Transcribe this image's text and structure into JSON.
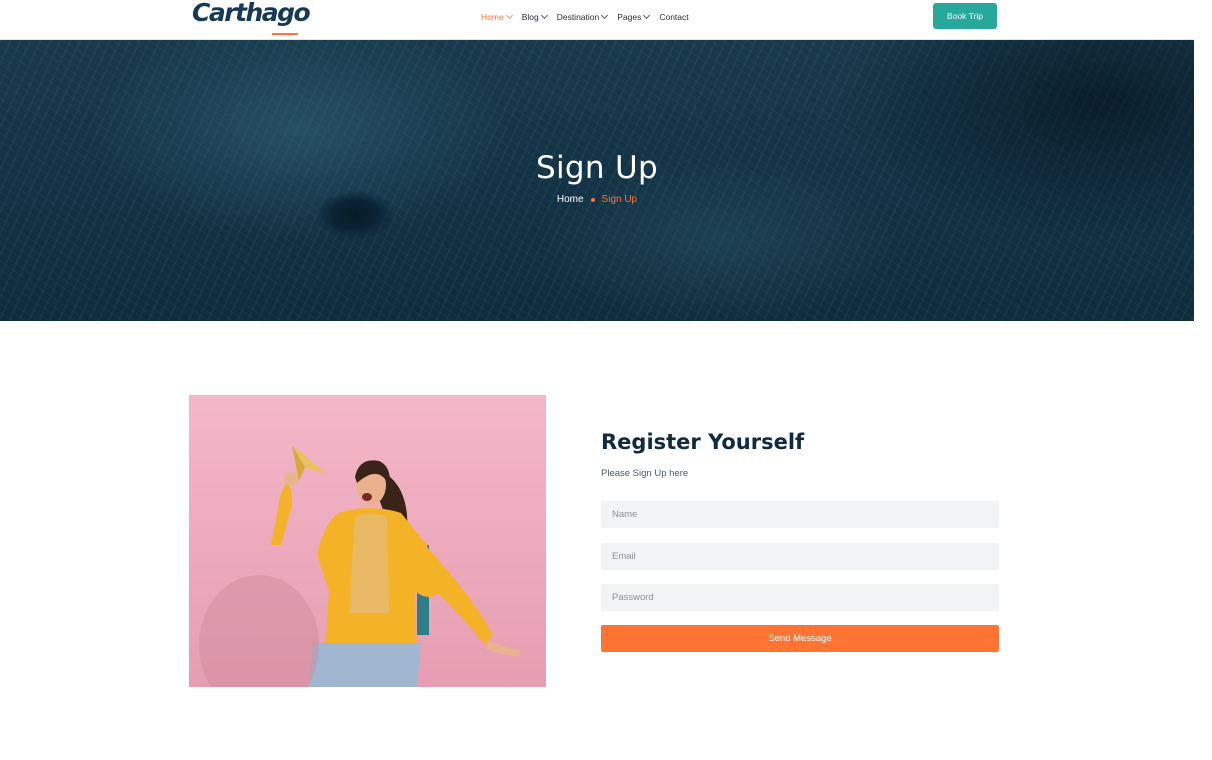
{
  "brand": {
    "logo_text": "Carthago",
    "logo_icon": "carthago-logo"
  },
  "nav": {
    "items": [
      {
        "label": "Home",
        "active": true,
        "has_dropdown": true
      },
      {
        "label": "Blog",
        "active": false,
        "has_dropdown": true
      },
      {
        "label": "Destination",
        "active": false,
        "has_dropdown": true
      },
      {
        "label": "Pages",
        "active": false,
        "has_dropdown": true
      },
      {
        "label": "Contact",
        "active": false,
        "has_dropdown": false
      }
    ],
    "cta_label": "Book Trip"
  },
  "hero": {
    "title": "Sign Up",
    "breadcrumb": {
      "home": "Home",
      "current": "Sign Up"
    }
  },
  "form": {
    "title": "Register Yourself",
    "subtitle": "Please Sign Up here",
    "name_placeholder": "Name",
    "email_placeholder": "Email",
    "password_placeholder": "Password",
    "submit_label": "Send Message"
  },
  "colors": {
    "accent": "#ff7433",
    "teal": "#28a79b",
    "heading": "#0f2b40",
    "hero_bg": "#123245",
    "photo_bg": "#eda9bc"
  }
}
